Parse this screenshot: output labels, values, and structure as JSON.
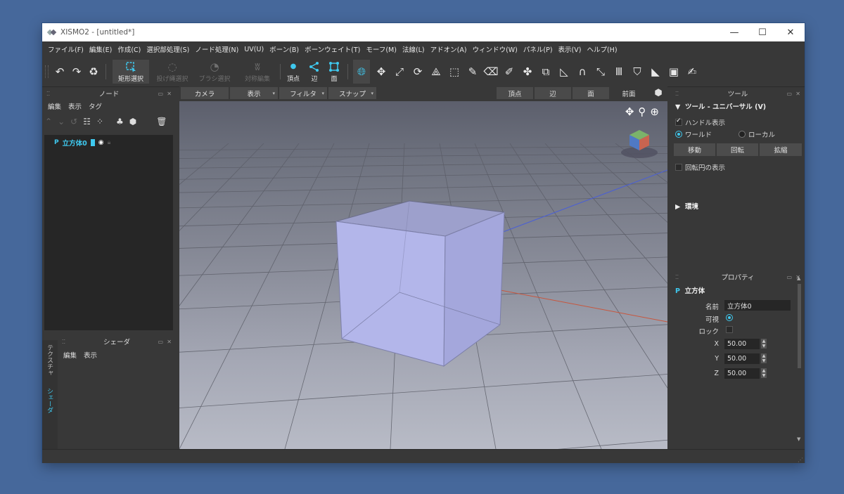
{
  "window": {
    "title": "XISMO2 - [untitled*]",
    "minimize": "—",
    "maximize": "☐",
    "close": "✕"
  },
  "menu": [
    "ファイル(F)",
    "編集(E)",
    "作成(C)",
    "選択部処理(S)",
    "ノード処理(N)",
    "UV(U)",
    "ボーン(B)",
    "ボーンウェイト(T)",
    "モーフ(M)",
    "法線(L)",
    "アドオン(A)",
    "ウィンドウ(W)",
    "パネル(P)",
    "表示(V)",
    "ヘルプ(H)"
  ],
  "toolbar": {
    "undo_icon": "↶",
    "redo_icon": "↷",
    "recycle_icon": "♻",
    "rect_select": "矩形選択",
    "lasso_select": "投げ縄選択",
    "brush_select": "ブラシ選択",
    "mirror_edit": "対称編集",
    "vertex": "頂点",
    "edge": "辺",
    "face": "面",
    "tool_icons": [
      "globe-icon",
      "move-icon",
      "scale-icon",
      "rotate-icon",
      "axis-icon",
      "marquee-icon",
      "pen-icon",
      "eraser-icon",
      "brush-icon",
      "bones-icon",
      "copy-icon",
      "shape-icon",
      "arch-icon",
      "shrink-icon",
      "extrude-icon",
      "bag-icon",
      "knife-icon",
      "film-icon",
      "edit-icon"
    ]
  },
  "node_panel": {
    "title": "ノード",
    "menu": [
      "編集",
      "表示",
      "タグ"
    ],
    "node": {
      "prefix": "P",
      "name": "立方体0"
    }
  },
  "shader_panel": {
    "title": "シェーダ",
    "menu": [
      "編集",
      "表示"
    ],
    "tabs": [
      "テクスチャ",
      "シェーダ"
    ]
  },
  "viewport": {
    "buttons": [
      "カメラ",
      "表示",
      "フィルタ",
      "スナップ"
    ],
    "modes": [
      "頂点",
      "辺",
      "面"
    ],
    "view_label": "前面"
  },
  "tool_panel": {
    "title": "ツール",
    "section": "ツール - ユニバーサル (V)",
    "handle_display": "ハンドル表示",
    "world": "ワールド",
    "local": "ローカル",
    "move": "移動",
    "rotate": "回転",
    "scale": "拡縮",
    "rotation_circle": "回転円の表示",
    "environment": "環境"
  },
  "properties": {
    "title": "プロパティ",
    "section": "立方体",
    "prefix": "P",
    "name_label": "名前",
    "name_value": "立方体0",
    "visible_label": "可視",
    "lock_label": "ロック",
    "x_label": "X",
    "x_value": "50.00",
    "y_label": "Y",
    "y_value": "50.00",
    "z_label": "Z",
    "z_value": "50.00"
  },
  "colors": {
    "accent": "#3fc9ef",
    "cube": "#b5b8ec",
    "x_axis": "#c8563d",
    "z_axis": "#4a5fd6"
  }
}
